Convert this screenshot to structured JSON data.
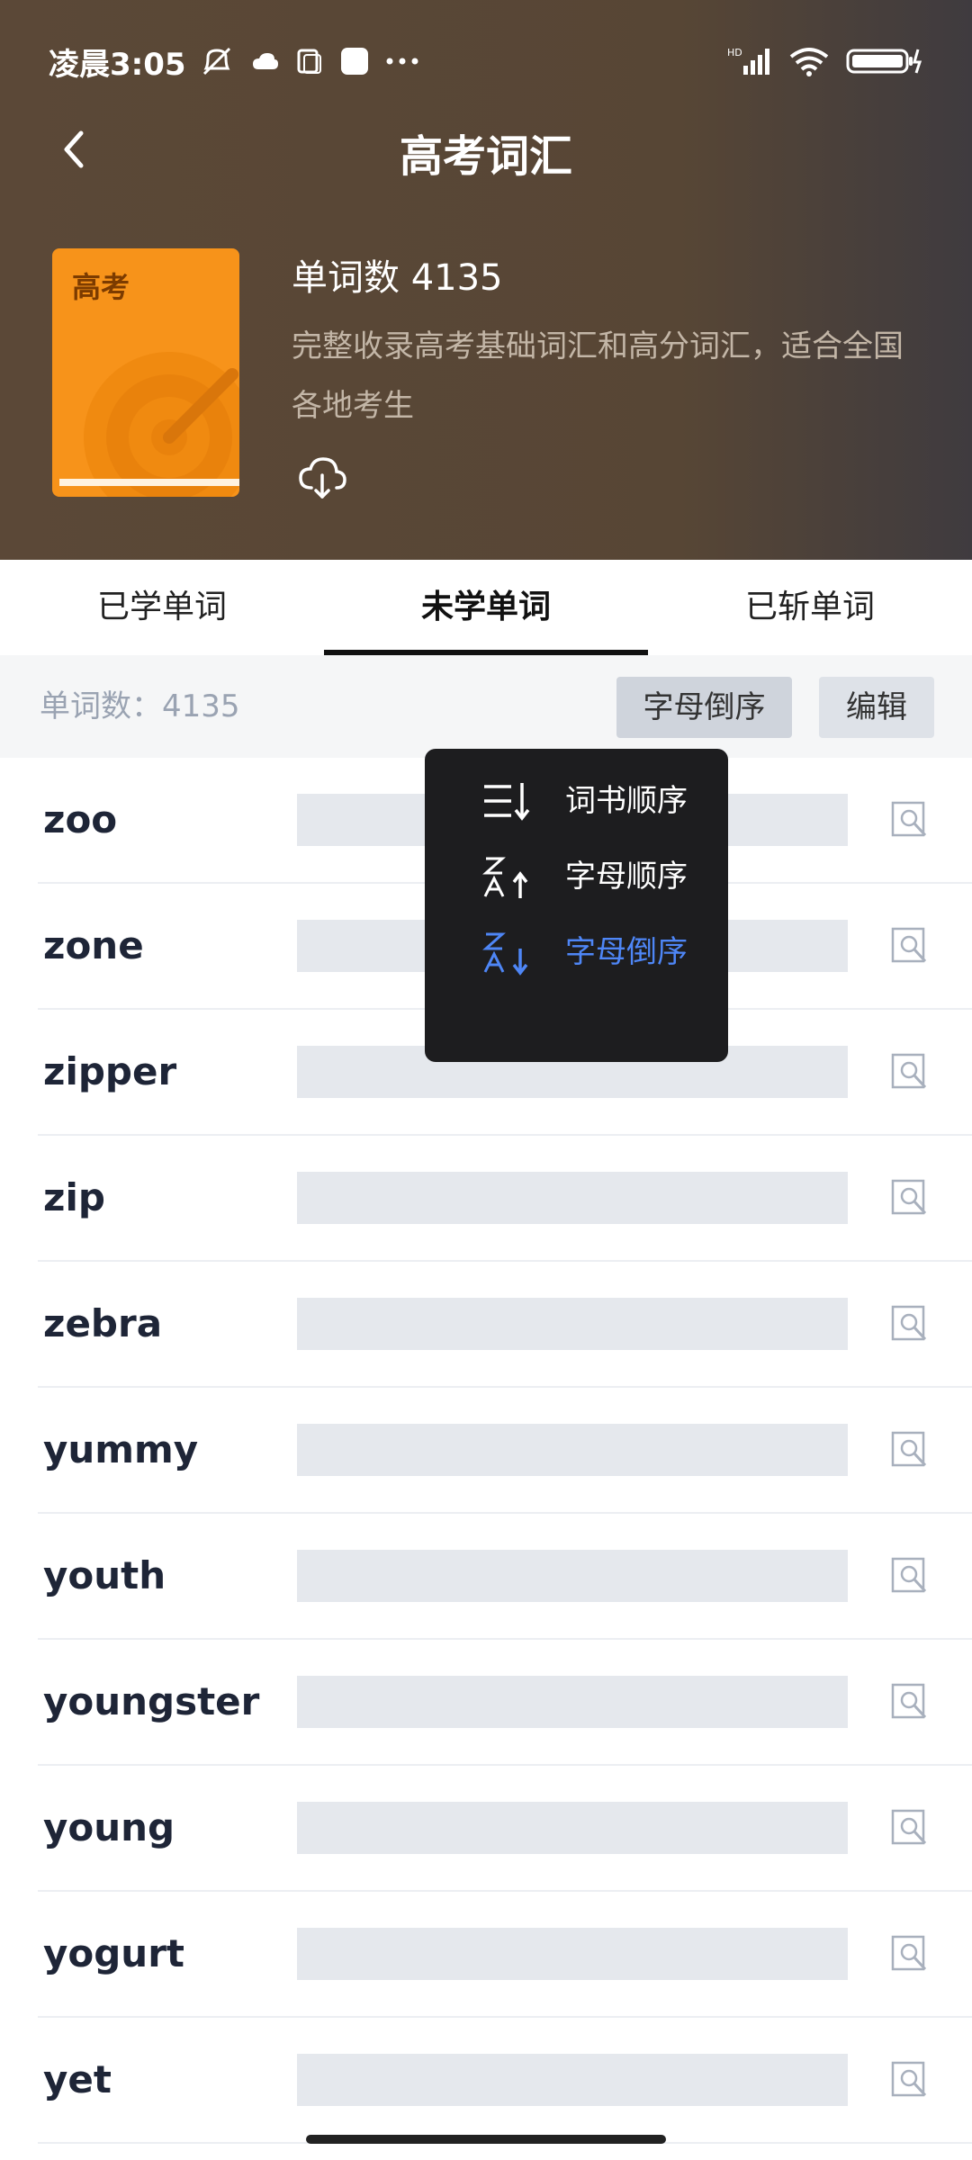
{
  "status_bar": {
    "time": "凌晨3:05"
  },
  "header": {
    "title": "高考词汇",
    "book_label": "高考",
    "word_count": "单词数 4135",
    "description": "完整收录高考基础词汇和高分词汇，适合全国各地考生"
  },
  "tabs": [
    {
      "label": "已学单词",
      "active": false
    },
    {
      "label": "未学单词",
      "active": true
    },
    {
      "label": "已斩单词",
      "active": false
    }
  ],
  "toolbar": {
    "word_count_label": "单词数：4135",
    "sort_button": "字母倒序",
    "edit_button": "编辑"
  },
  "sort_menu": {
    "items": [
      {
        "label": "词书顺序",
        "icon": "book-order-icon",
        "selected": false
      },
      {
        "label": "字母顺序",
        "icon": "sort-az-ascending-icon",
        "selected": false
      },
      {
        "label": "字母倒序",
        "icon": "sort-za-descending-icon",
        "selected": true
      }
    ]
  },
  "words": [
    "zoo",
    "zone",
    "zipper",
    "zip",
    "zebra",
    "yummy",
    "youth",
    "youngster",
    "young",
    "yogurt",
    "yet"
  ],
  "colors": {
    "header_bg": "#5b4837",
    "book_orange": "#f7931a",
    "selected_blue": "#4e86f6",
    "menu_bg": "#1d1d1f"
  }
}
